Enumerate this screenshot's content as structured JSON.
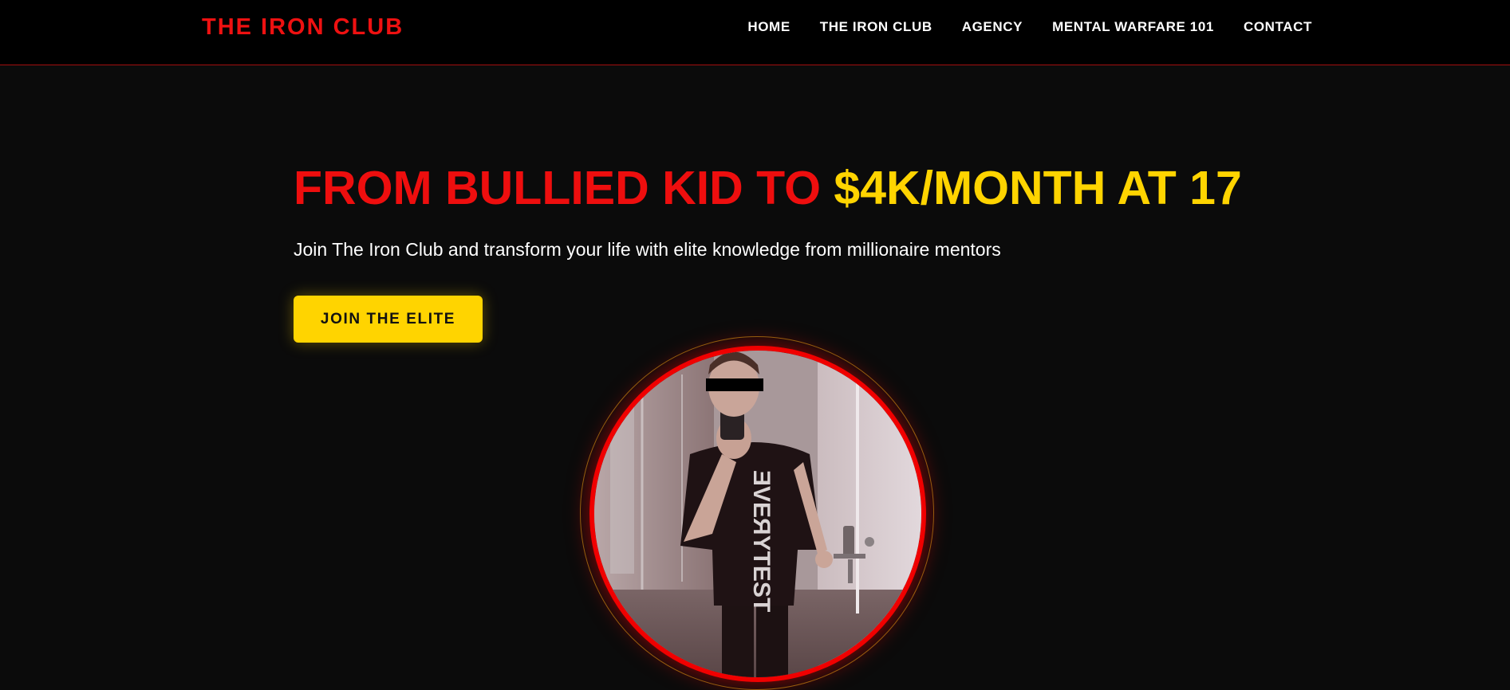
{
  "nav": {
    "logo": "THE IRON CLUB",
    "links": [
      "HOME",
      "THE IRON CLUB",
      "AGENCY",
      "MENTAL WARFARE 101",
      "CONTACT"
    ]
  },
  "hero": {
    "headline_red": "FROM BULLIED KID TO ",
    "headline_gold": "$4K/MONTH AT 17",
    "subtitle": "Join The Iron Club and transform your life with elite knowledge from millionaire mentors",
    "cta_label": "JOIN THE ELITE",
    "photo": {
      "shirt_text": "EVERYTEST",
      "description_icon": "person-mirror-selfie-photo"
    }
  },
  "colors": {
    "background": "#0b0b0b",
    "navbar": "#000000",
    "accent_red": "#ee0e0e",
    "accent_gold": "#ffd400"
  }
}
